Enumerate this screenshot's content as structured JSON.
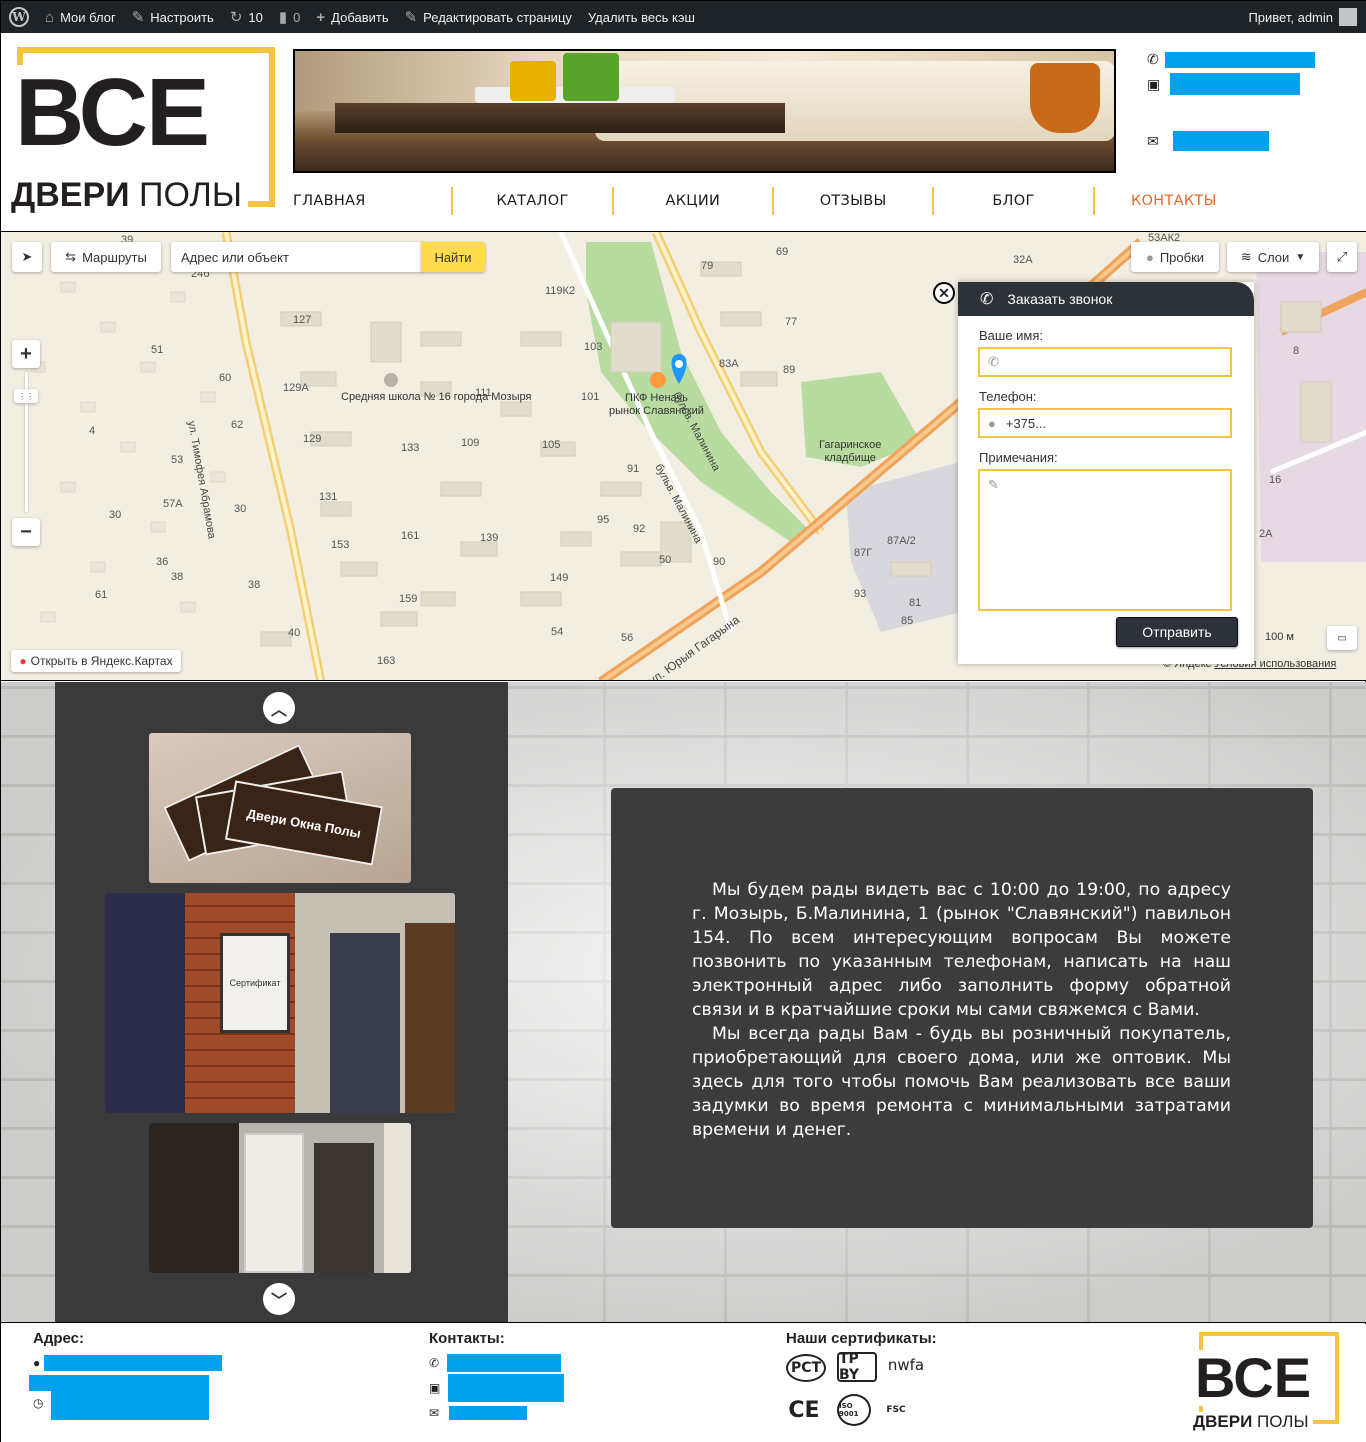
{
  "admin_bar": {
    "my_blog": "Мои блог",
    "customize": "Настроить",
    "updates_count": "10",
    "comments_count": "0",
    "add_new": "Добавить",
    "edit_page": "Редактировать страницу",
    "clear_cache": "Удалить весь кэш",
    "greeting": "Привет, admin"
  },
  "logo": {
    "big": "ВСЕ",
    "small_bold": "ДВЕРИ",
    "small_light": "ПОЛЫ"
  },
  "nav": [
    {
      "label": "ГЛАВНАЯ"
    },
    {
      "label": "КАТАЛОГ"
    },
    {
      "label": "АКЦИИ"
    },
    {
      "label": "ОТЗЫВЫ"
    },
    {
      "label": "БЛОГ"
    },
    {
      "label": "КОНТАКТЫ",
      "active": true
    }
  ],
  "colors": {
    "accent": "#f5c343",
    "active_nav": "#e8692c",
    "redaction": "#00a2ed",
    "dark": "#2d3238"
  },
  "map": {
    "routes_label": "Маршруты",
    "search_placeholder": "Адрес или объект",
    "search_button": "Найти",
    "traffic_label": "Пробки",
    "layers_label": "Слои",
    "open_in_yandex": "Открыть в Яндекс.Картах",
    "scale_label": "100 м",
    "copyright": "© Яндекс",
    "terms": "Условия использования",
    "places": {
      "school": "Средняя школа №\n16 города Мозыря",
      "market": "ПКФ Неначь\nрынок Славянский",
      "cemetery": "Гагаринское\nкладбище"
    },
    "streets": {
      "malinina1": "бульв. Малинина",
      "malinina2": "бульв. Малинина",
      "gagarina": "вул. Юрыя Гагарына",
      "abramova": "ул. Тимофея Абрамова"
    },
    "house_numbers": [
      "39",
      "24б",
      "127",
      "51",
      "60",
      "129А",
      "62",
      "4",
      "129",
      "53",
      "57А",
      "30",
      "131",
      "153",
      "30",
      "36",
      "38",
      "38",
      "61",
      "40",
      "163",
      "133",
      "161",
      "159",
      "111",
      "109",
      "139",
      "105",
      "101",
      "103",
      "119К2",
      "79",
      "77",
      "69",
      "83А",
      "89",
      "91",
      "95",
      "92",
      "50",
      "149",
      "54",
      "56",
      "90",
      "87Г",
      "87А/2",
      "93",
      "81",
      "85",
      "32А",
      "53АК2",
      "8",
      "16",
      "2А"
    ]
  },
  "callback_form": {
    "title": "Заказать звонок",
    "name_label": "Ваше имя:",
    "phone_label": "Телефон:",
    "phone_placeholder": "+375...",
    "notes_label": "Примечания:",
    "submit": "Отправить"
  },
  "about": {
    "paragraph1": "Мы будем рады видеть вас с 10:00 до 19:00, по адресу г. Мозырь, Б.Малинина, 1 (рынок \"Славянский\") павильон 154. По всем интересующим вопросам Вы можете позвонить по указанным телефонам, написать на наш электронный адрес либо заполнить форму обратной связи и в кратчайшие сроки мы сами свяжемся с Вами.",
    "paragraph2": "Мы всегда рады Вам - будь вы розничный покупатель, приобретающий для своего дома, или же оптовик. Мы здесь для того чтобы помочь Вам реализовать все ваши задумки во время ремонта с минимальными затратами времени и денег."
  },
  "gallery": {
    "card_text": "Двери Окна Полы",
    "certificate_text": "Сертификат"
  },
  "footer": {
    "address_title": "Адрес:",
    "contacts_title": "Контакты:",
    "certificates_title": "Наши сертификаты:",
    "certs": [
      "РСТ",
      "ТР BY",
      "nwfa",
      "CE",
      "ISO 9001",
      "FSC"
    ]
  }
}
